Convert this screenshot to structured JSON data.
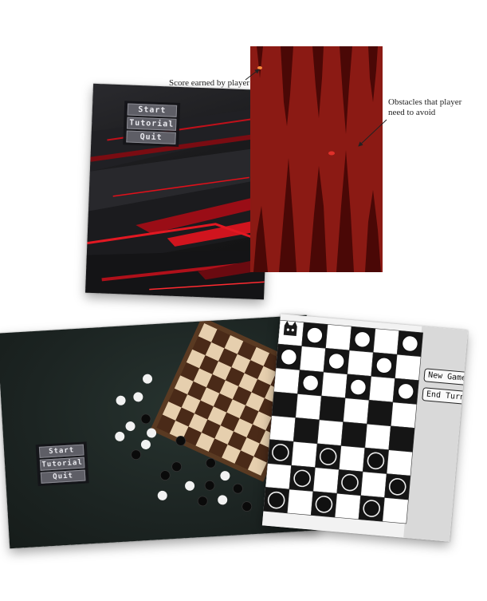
{
  "menu": {
    "start": "Start",
    "tutorial": "Tutorial",
    "quit": "Quit"
  },
  "annotations": {
    "score": "Score earned by player",
    "obstacles_line1": "Obstacles that player",
    "obstacles_line2": "need to avoid"
  },
  "checkers_board": {
    "new_game": "New Game",
    "end_turn": "End Turn"
  },
  "colors": {
    "obstacle_bg": "#8b1a14",
    "obstacle_spike": "#4a0806",
    "menu_button": "#5e5e66",
    "red_accent": "#e0101a"
  },
  "icons": [
    "cat-face-icon"
  ]
}
